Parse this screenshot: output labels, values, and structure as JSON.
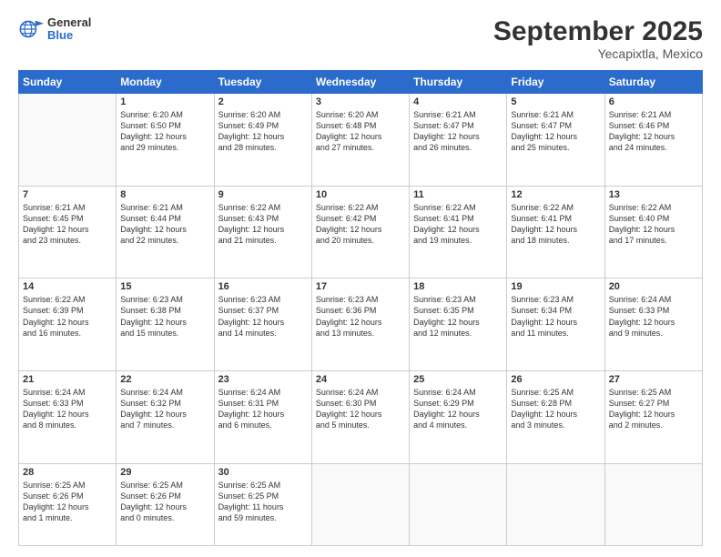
{
  "logo": {
    "line1": "General",
    "line2": "Blue"
  },
  "title": "September 2025",
  "subtitle": "Yecapixtla, Mexico",
  "days_of_week": [
    "Sunday",
    "Monday",
    "Tuesday",
    "Wednesday",
    "Thursday",
    "Friday",
    "Saturday"
  ],
  "weeks": [
    [
      {
        "day": "",
        "info": ""
      },
      {
        "day": "1",
        "info": "Sunrise: 6:20 AM\nSunset: 6:50 PM\nDaylight: 12 hours\nand 29 minutes."
      },
      {
        "day": "2",
        "info": "Sunrise: 6:20 AM\nSunset: 6:49 PM\nDaylight: 12 hours\nand 28 minutes."
      },
      {
        "day": "3",
        "info": "Sunrise: 6:20 AM\nSunset: 6:48 PM\nDaylight: 12 hours\nand 27 minutes."
      },
      {
        "day": "4",
        "info": "Sunrise: 6:21 AM\nSunset: 6:47 PM\nDaylight: 12 hours\nand 26 minutes."
      },
      {
        "day": "5",
        "info": "Sunrise: 6:21 AM\nSunset: 6:47 PM\nDaylight: 12 hours\nand 25 minutes."
      },
      {
        "day": "6",
        "info": "Sunrise: 6:21 AM\nSunset: 6:46 PM\nDaylight: 12 hours\nand 24 minutes."
      }
    ],
    [
      {
        "day": "7",
        "info": "Sunrise: 6:21 AM\nSunset: 6:45 PM\nDaylight: 12 hours\nand 23 minutes."
      },
      {
        "day": "8",
        "info": "Sunrise: 6:21 AM\nSunset: 6:44 PM\nDaylight: 12 hours\nand 22 minutes."
      },
      {
        "day": "9",
        "info": "Sunrise: 6:22 AM\nSunset: 6:43 PM\nDaylight: 12 hours\nand 21 minutes."
      },
      {
        "day": "10",
        "info": "Sunrise: 6:22 AM\nSunset: 6:42 PM\nDaylight: 12 hours\nand 20 minutes."
      },
      {
        "day": "11",
        "info": "Sunrise: 6:22 AM\nSunset: 6:41 PM\nDaylight: 12 hours\nand 19 minutes."
      },
      {
        "day": "12",
        "info": "Sunrise: 6:22 AM\nSunset: 6:41 PM\nDaylight: 12 hours\nand 18 minutes."
      },
      {
        "day": "13",
        "info": "Sunrise: 6:22 AM\nSunset: 6:40 PM\nDaylight: 12 hours\nand 17 minutes."
      }
    ],
    [
      {
        "day": "14",
        "info": "Sunrise: 6:22 AM\nSunset: 6:39 PM\nDaylight: 12 hours\nand 16 minutes."
      },
      {
        "day": "15",
        "info": "Sunrise: 6:23 AM\nSunset: 6:38 PM\nDaylight: 12 hours\nand 15 minutes."
      },
      {
        "day": "16",
        "info": "Sunrise: 6:23 AM\nSunset: 6:37 PM\nDaylight: 12 hours\nand 14 minutes."
      },
      {
        "day": "17",
        "info": "Sunrise: 6:23 AM\nSunset: 6:36 PM\nDaylight: 12 hours\nand 13 minutes."
      },
      {
        "day": "18",
        "info": "Sunrise: 6:23 AM\nSunset: 6:35 PM\nDaylight: 12 hours\nand 12 minutes."
      },
      {
        "day": "19",
        "info": "Sunrise: 6:23 AM\nSunset: 6:34 PM\nDaylight: 12 hours\nand 11 minutes."
      },
      {
        "day": "20",
        "info": "Sunrise: 6:24 AM\nSunset: 6:33 PM\nDaylight: 12 hours\nand 9 minutes."
      }
    ],
    [
      {
        "day": "21",
        "info": "Sunrise: 6:24 AM\nSunset: 6:33 PM\nDaylight: 12 hours\nand 8 minutes."
      },
      {
        "day": "22",
        "info": "Sunrise: 6:24 AM\nSunset: 6:32 PM\nDaylight: 12 hours\nand 7 minutes."
      },
      {
        "day": "23",
        "info": "Sunrise: 6:24 AM\nSunset: 6:31 PM\nDaylight: 12 hours\nand 6 minutes."
      },
      {
        "day": "24",
        "info": "Sunrise: 6:24 AM\nSunset: 6:30 PM\nDaylight: 12 hours\nand 5 minutes."
      },
      {
        "day": "25",
        "info": "Sunrise: 6:24 AM\nSunset: 6:29 PM\nDaylight: 12 hours\nand 4 minutes."
      },
      {
        "day": "26",
        "info": "Sunrise: 6:25 AM\nSunset: 6:28 PM\nDaylight: 12 hours\nand 3 minutes."
      },
      {
        "day": "27",
        "info": "Sunrise: 6:25 AM\nSunset: 6:27 PM\nDaylight: 12 hours\nand 2 minutes."
      }
    ],
    [
      {
        "day": "28",
        "info": "Sunrise: 6:25 AM\nSunset: 6:26 PM\nDaylight: 12 hours\nand 1 minute."
      },
      {
        "day": "29",
        "info": "Sunrise: 6:25 AM\nSunset: 6:26 PM\nDaylight: 12 hours\nand 0 minutes."
      },
      {
        "day": "30",
        "info": "Sunrise: 6:25 AM\nSunset: 6:25 PM\nDaylight: 11 hours\nand 59 minutes."
      },
      {
        "day": "",
        "info": ""
      },
      {
        "day": "",
        "info": ""
      },
      {
        "day": "",
        "info": ""
      },
      {
        "day": "",
        "info": ""
      }
    ]
  ]
}
